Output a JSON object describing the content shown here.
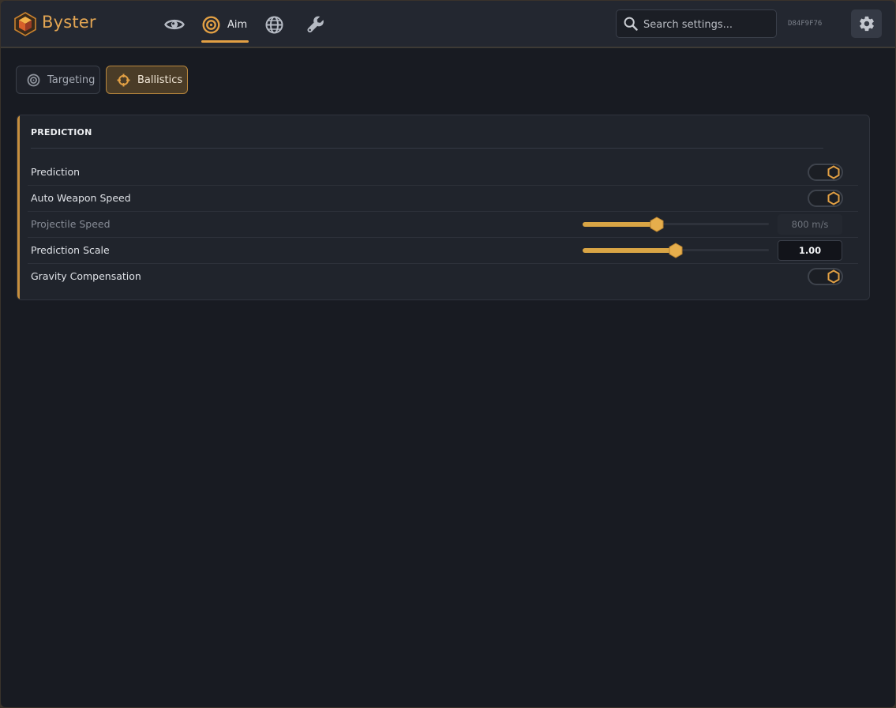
{
  "app": {
    "brand": "Byster",
    "hwid": "D84F9F76",
    "accent_color": "#e2a044"
  },
  "nav": {
    "items": [
      {
        "icon": "eye-icon"
      },
      {
        "icon": "target-icon",
        "label": "Aim",
        "active": true
      },
      {
        "icon": "globe-icon"
      },
      {
        "icon": "wrench-icon"
      }
    ]
  },
  "search": {
    "placeholder": "Search settings..."
  },
  "subtabs": [
    {
      "label": "Targeting",
      "icon": "target-icon",
      "active": false
    },
    {
      "label": "Ballistics",
      "icon": "crosshair-icon",
      "active": true
    }
  ],
  "panel": {
    "title": "PREDICTION",
    "rows": [
      {
        "label": "Prediction",
        "control": "toggle",
        "enabled": false
      },
      {
        "label": "Auto Weapon Speed",
        "control": "toggle",
        "enabled": false
      },
      {
        "label": "Projectile Speed",
        "control": "slider",
        "value_text": "800 m/s",
        "fraction": 0.4,
        "disabled": true
      },
      {
        "label": "Prediction Scale",
        "control": "slider",
        "value_text": "1.00",
        "fraction": 0.5,
        "disabled": false
      },
      {
        "label": "Gravity Compensation",
        "control": "toggle",
        "enabled": false
      }
    ]
  }
}
